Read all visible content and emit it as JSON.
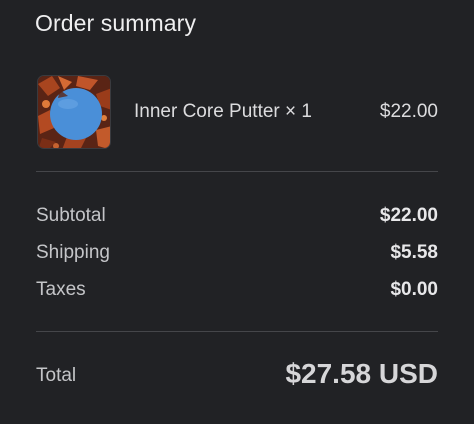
{
  "summary": {
    "title": "Order summary"
  },
  "item": {
    "name": "Inner Core Putter × 1",
    "price": "$22.00",
    "thumbnail": "blue-disc-on-autumn-leaves"
  },
  "costs": {
    "subtotal_label": "Subtotal",
    "subtotal_value": "$22.00",
    "shipping_label": "Shipping",
    "shipping_value": "$5.58",
    "taxes_label": "Taxes",
    "taxes_value": "$0.00"
  },
  "total": {
    "label": "Total",
    "value": "$27.58 USD"
  },
  "colors": {
    "background": "#212225",
    "disc": "#4a8fd8",
    "divider": "#45464a"
  }
}
